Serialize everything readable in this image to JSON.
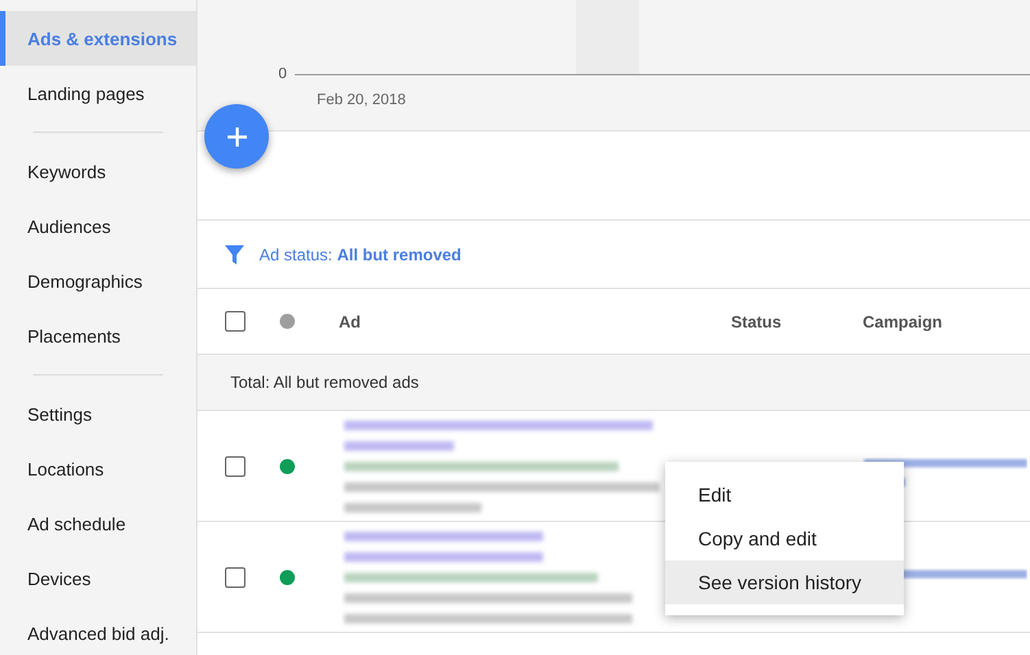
{
  "sidebar": {
    "items": [
      {
        "label": "Ads & extensions",
        "selected": true
      },
      {
        "label": "Landing pages",
        "selected": false
      },
      {
        "kind": "divider"
      },
      {
        "label": "Keywords",
        "selected": false
      },
      {
        "label": "Audiences",
        "selected": false
      },
      {
        "label": "Demographics",
        "selected": false
      },
      {
        "label": "Placements",
        "selected": false
      },
      {
        "kind": "divider"
      },
      {
        "label": "Settings",
        "selected": false
      },
      {
        "label": "Locations",
        "selected": false
      },
      {
        "label": "Ad schedule",
        "selected": false
      },
      {
        "label": "Devices",
        "selected": false
      },
      {
        "label": "Advanced bid adj.",
        "selected": false
      }
    ]
  },
  "chart": {
    "y_tick": "0",
    "x_tick": "Feb 20, 2018"
  },
  "filter": {
    "text": "Ad status: **All but removed**"
  },
  "table": {
    "columns": [
      "Ad",
      "Status",
      "Campaign"
    ],
    "total_row": "Total: All but removed ads",
    "select_all": {
      "checked": false
    },
    "rows": [
      {
        "checked": false,
        "color": "#0f9d58"
      },
      {
        "checked": false,
        "color": "#0f9d58"
      }
    ]
  },
  "context_menu": {
    "items": [
      {
        "label": "Edit",
        "selected": false
      },
      {
        "label": "Copy and edit",
        "selected": false
      },
      {
        "label": "See version history",
        "selected": true
      }
    ]
  }
}
